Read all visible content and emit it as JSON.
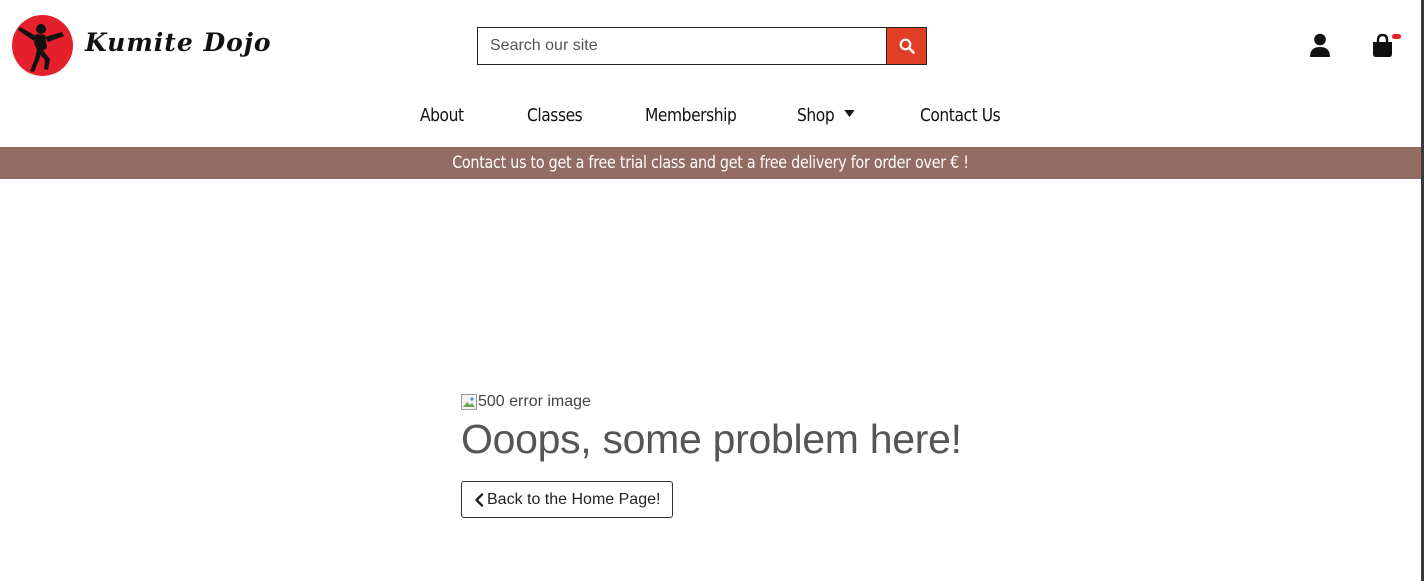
{
  "header": {
    "brand_name": "Kumite Dojo",
    "search": {
      "placeholder": "Search our site",
      "button_icon": "search-icon",
      "accent_color": "#e03e25"
    },
    "account_icon": "user-icon",
    "cart_icon": "shopping-bag-icon"
  },
  "nav": {
    "items": [
      {
        "label": "About"
      },
      {
        "label": "Classes"
      },
      {
        "label": "Membership"
      },
      {
        "label": "Shop",
        "has_dropdown": true
      },
      {
        "label": "Contact Us"
      }
    ]
  },
  "banner": {
    "text": "Contact us to get a free trial class and get a free delivery for order over € !",
    "background_color": "#936c63"
  },
  "main": {
    "image_alt": "500 error image",
    "title": "Ooops, some problem here!",
    "back_button_label": "Back to the Home Page!"
  }
}
